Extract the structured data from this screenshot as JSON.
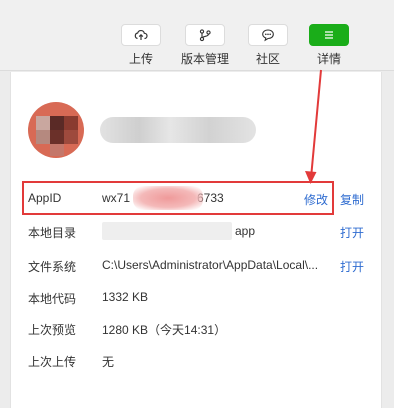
{
  "toolbar": {
    "upload_label": "上传",
    "version_label": "版本管理",
    "community_label": "社区",
    "details_label": "详情"
  },
  "details": {
    "appid_label": "AppID",
    "appid_value_prefix": "wx71",
    "appid_value_suffix": "6733",
    "modify_link": "修改",
    "copy_link": "复制",
    "local_dir_label": "本地目录",
    "local_dir_suffix": "app",
    "local_dir_open": "打开",
    "filesystem_label": "文件系统",
    "filesystem_value": "C:\\Users\\Administrator\\AppData\\Local\\...",
    "filesystem_open": "打开",
    "local_code_label": "本地代码",
    "local_code_value": "1332 KB",
    "last_preview_label": "上次预览",
    "last_preview_value": "1280 KB（今天14:31）",
    "last_upload_label": "上次上传",
    "last_upload_value": "无"
  },
  "colors": {
    "accent_green": "#1aad19",
    "link_blue": "#2f6cd0",
    "annotation_red": "#e23a3a"
  }
}
